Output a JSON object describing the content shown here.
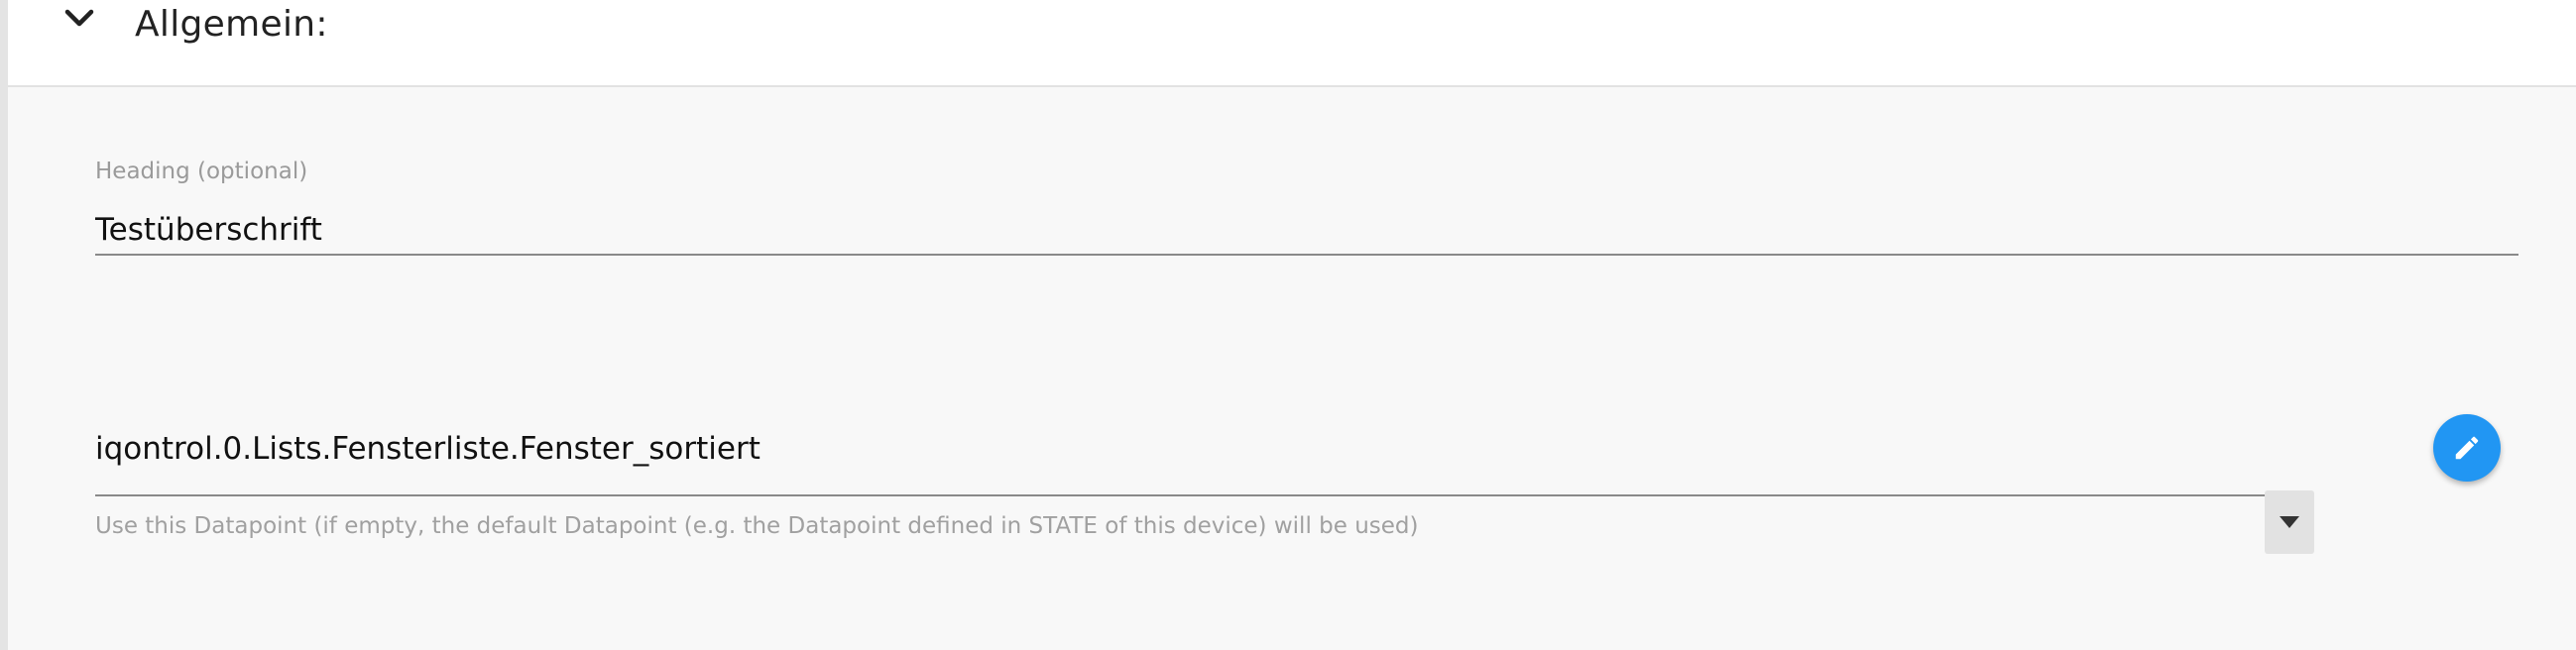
{
  "section": {
    "title": "Allgemein:",
    "expand_icon": "chevron-down-icon"
  },
  "heading_field": {
    "label": "Heading (optional)",
    "value": "Testüberschrift"
  },
  "datapoint_field": {
    "value": "iqontrol.0.Lists.Fensterliste.Fenster_sortiert",
    "dropdown_icon": "caret-down-icon",
    "helper": "Use this Datapoint (if empty, the default Datapoint (e.g. the Datapoint defined in STATE of this device) will be used)"
  },
  "edit_button": {
    "icon": "pencil-icon"
  },
  "colors": {
    "accent": "#2196f3",
    "panel_background": "#f8f8f8",
    "label_gray": "#9a9a9a"
  }
}
